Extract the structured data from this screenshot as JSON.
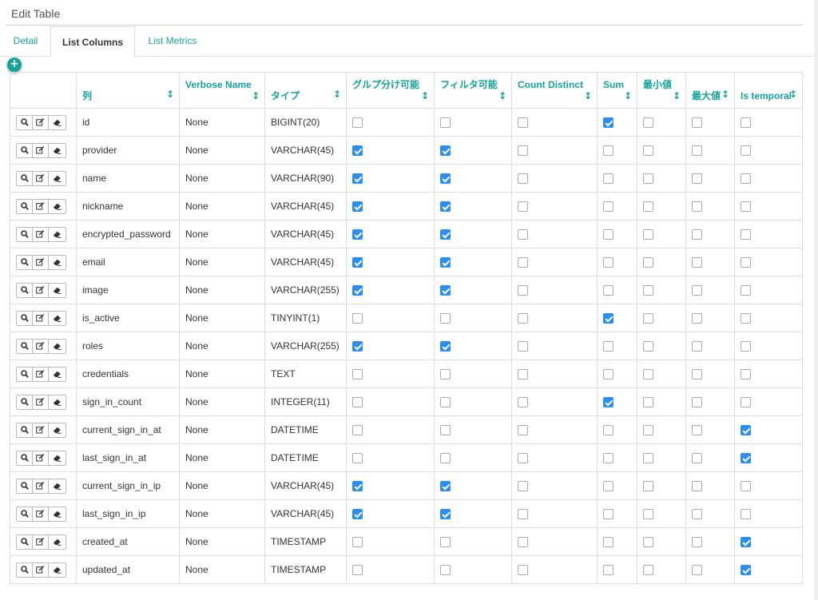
{
  "panel": {
    "title": "Edit Table"
  },
  "tabs": [
    {
      "label": "Detail"
    },
    {
      "label": "List Columns"
    },
    {
      "label": "List Metrics"
    }
  ],
  "add_button": {
    "icon": "plus-icon",
    "label": "+"
  },
  "table": {
    "headers": [
      "列",
      "Verbose Name",
      "タイプ",
      "グルプ分け可能",
      "フィルタ可能",
      "Count Distinct",
      "Sum",
      "最小値",
      "最大値",
      "Is temporal"
    ],
    "row_action_icons": [
      "search-icon",
      "edit-icon",
      "eraser-icon"
    ],
    "rows": [
      {
        "column": "id",
        "verbose": "None",
        "type": "BIGINT(20)",
        "groupby": false,
        "filterable": false,
        "count_distinct": false,
        "sum": true,
        "min": false,
        "max": false,
        "temporal": false
      },
      {
        "column": "provider",
        "verbose": "None",
        "type": "VARCHAR(45)",
        "groupby": true,
        "filterable": true,
        "count_distinct": false,
        "sum": false,
        "min": false,
        "max": false,
        "temporal": false
      },
      {
        "column": "name",
        "verbose": "None",
        "type": "VARCHAR(90)",
        "groupby": true,
        "filterable": true,
        "count_distinct": false,
        "sum": false,
        "min": false,
        "max": false,
        "temporal": false
      },
      {
        "column": "nickname",
        "verbose": "None",
        "type": "VARCHAR(45)",
        "groupby": true,
        "filterable": true,
        "count_distinct": false,
        "sum": false,
        "min": false,
        "max": false,
        "temporal": false
      },
      {
        "column": "encrypted_password",
        "verbose": "None",
        "type": "VARCHAR(45)",
        "groupby": true,
        "filterable": true,
        "count_distinct": false,
        "sum": false,
        "min": false,
        "max": false,
        "temporal": false
      },
      {
        "column": "email",
        "verbose": "None",
        "type": "VARCHAR(45)",
        "groupby": true,
        "filterable": true,
        "count_distinct": false,
        "sum": false,
        "min": false,
        "max": false,
        "temporal": false
      },
      {
        "column": "image",
        "verbose": "None",
        "type": "VARCHAR(255)",
        "groupby": true,
        "filterable": true,
        "count_distinct": false,
        "sum": false,
        "min": false,
        "max": false,
        "temporal": false
      },
      {
        "column": "is_active",
        "verbose": "None",
        "type": "TINYINT(1)",
        "groupby": false,
        "filterable": false,
        "count_distinct": false,
        "sum": true,
        "min": false,
        "max": false,
        "temporal": false
      },
      {
        "column": "roles",
        "verbose": "None",
        "type": "VARCHAR(255)",
        "groupby": true,
        "filterable": true,
        "count_distinct": false,
        "sum": false,
        "min": false,
        "max": false,
        "temporal": false
      },
      {
        "column": "credentials",
        "verbose": "None",
        "type": "TEXT",
        "groupby": false,
        "filterable": false,
        "count_distinct": false,
        "sum": false,
        "min": false,
        "max": false,
        "temporal": false
      },
      {
        "column": "sign_in_count",
        "verbose": "None",
        "type": "INTEGER(11)",
        "groupby": false,
        "filterable": false,
        "count_distinct": false,
        "sum": true,
        "min": false,
        "max": false,
        "temporal": false
      },
      {
        "column": "current_sign_in_at",
        "verbose": "None",
        "type": "DATETIME",
        "groupby": false,
        "filterable": false,
        "count_distinct": false,
        "sum": false,
        "min": false,
        "max": false,
        "temporal": true
      },
      {
        "column": "last_sign_in_at",
        "verbose": "None",
        "type": "DATETIME",
        "groupby": false,
        "filterable": false,
        "count_distinct": false,
        "sum": false,
        "min": false,
        "max": false,
        "temporal": true
      },
      {
        "column": "current_sign_in_ip",
        "verbose": "None",
        "type": "VARCHAR(45)",
        "groupby": true,
        "filterable": true,
        "count_distinct": false,
        "sum": false,
        "min": false,
        "max": false,
        "temporal": false
      },
      {
        "column": "last_sign_in_ip",
        "verbose": "None",
        "type": "VARCHAR(45)",
        "groupby": true,
        "filterable": true,
        "count_distinct": false,
        "sum": false,
        "min": false,
        "max": false,
        "temporal": false
      },
      {
        "column": "created_at",
        "verbose": "None",
        "type": "TIMESTAMP",
        "groupby": false,
        "filterable": false,
        "count_distinct": false,
        "sum": false,
        "min": false,
        "max": false,
        "temporal": true
      },
      {
        "column": "updated_at",
        "verbose": "None",
        "type": "TIMESTAMP",
        "groupby": false,
        "filterable": false,
        "count_distinct": false,
        "sum": false,
        "min": false,
        "max": false,
        "temporal": true
      }
    ]
  },
  "colors": {
    "accent": "#14a49a",
    "checkbox_checked": "#2b8ff2"
  }
}
